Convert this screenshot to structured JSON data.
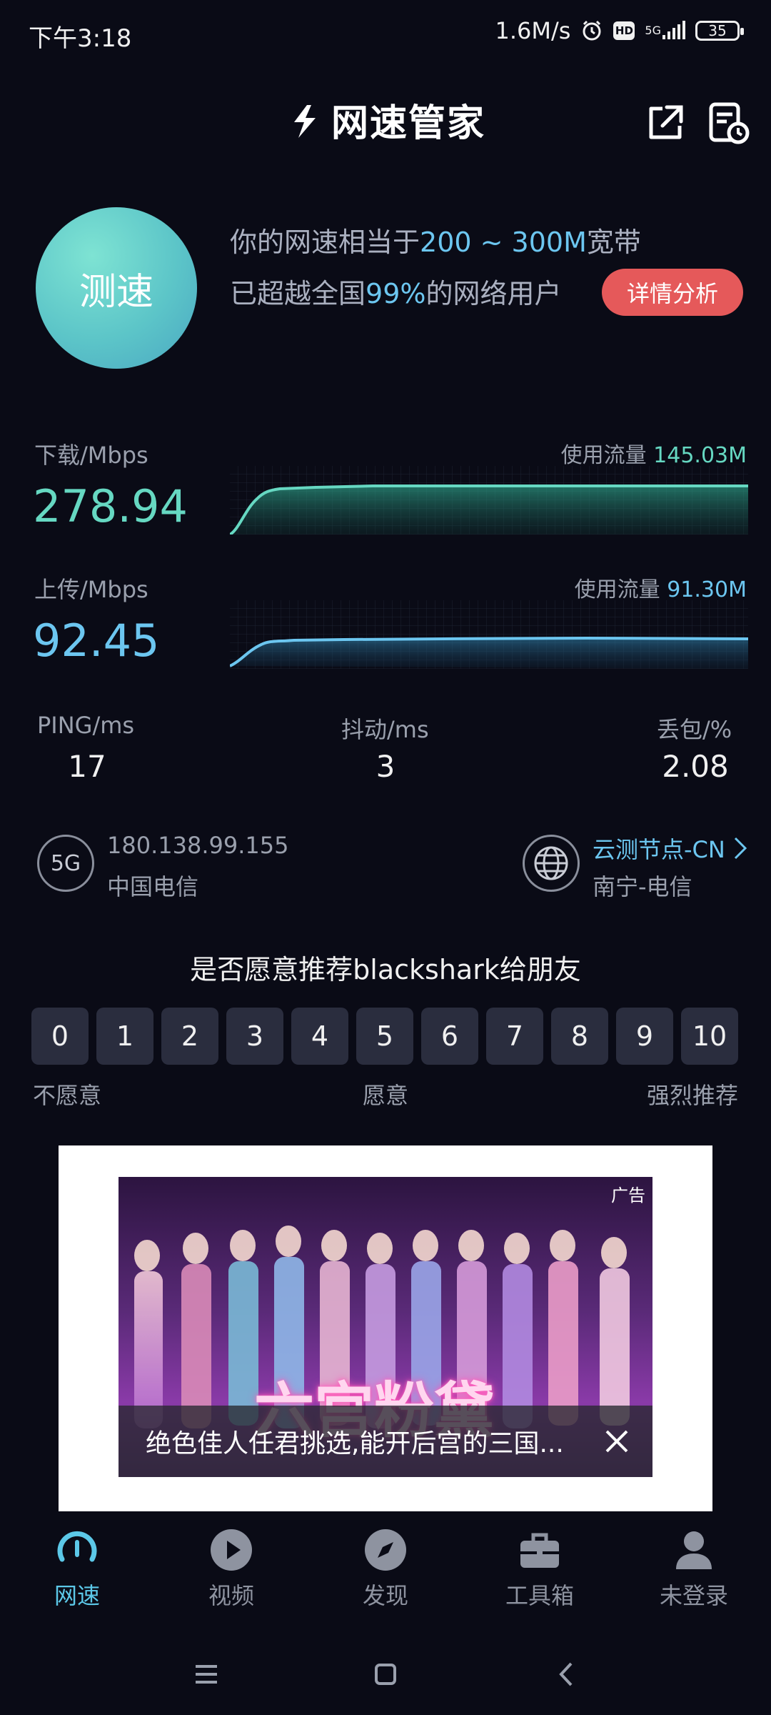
{
  "status_bar": {
    "time": "下午3:18",
    "net_speed": "1.6M/s",
    "hd_badge": "HD",
    "signal_type": "5G",
    "battery": "35"
  },
  "header": {
    "title": "网速管家"
  },
  "speed_test": {
    "button_label": "测速",
    "summary_prefix": "你的网速相当于",
    "summary_highlight": "200 ~ 300M",
    "summary_suffix": "宽带",
    "rank_prefix": "已超越全国",
    "rank_highlight": "99%",
    "rank_suffix": "的网络用户",
    "detail_button": "详情分析"
  },
  "download": {
    "label": "下载/Mbps",
    "value": "278.94",
    "traffic_label": "使用流量",
    "traffic_value": "145.03M"
  },
  "upload": {
    "label": "上传/Mbps",
    "value": "92.45",
    "traffic_label": "使用流量",
    "traffic_value": "91.30M"
  },
  "stats": {
    "ping_label": "PING/ms",
    "ping_value": "17",
    "jitter_label": "抖动/ms",
    "jitter_value": "3",
    "loss_label": "丢包/%",
    "loss_value": "2.08"
  },
  "network": {
    "type_badge": "5G",
    "ip": "180.138.99.155",
    "isp": "中国电信",
    "node_name": "云测节点-CN",
    "node_location": "南宁-电信"
  },
  "survey": {
    "question": "是否愿意推荐blackshark给朋友",
    "scores": [
      "0",
      "1",
      "2",
      "3",
      "4",
      "5",
      "6",
      "7",
      "8",
      "9",
      "10"
    ],
    "label_low": "不愿意",
    "label_mid": "愿意",
    "label_high": "强烈推荐"
  },
  "ad": {
    "badge": "广告",
    "art_title": "六宫粉黛",
    "caption": "绝色佳人任君挑选,能开后宫的三国..."
  },
  "bottom_nav": {
    "items": [
      {
        "label": "网速",
        "icon": "speedometer-icon"
      },
      {
        "label": "视频",
        "icon": "play-icon"
      },
      {
        "label": "发现",
        "icon": "compass-icon"
      },
      {
        "label": "工具箱",
        "icon": "toolbox-icon"
      },
      {
        "label": "未登录",
        "icon": "user-icon"
      }
    ],
    "active_index": 0
  },
  "colors": {
    "accent_green": "#66d8c2",
    "accent_blue": "#6cc6f0",
    "detail_button": "#e5595a",
    "background": "#0a0b16"
  }
}
